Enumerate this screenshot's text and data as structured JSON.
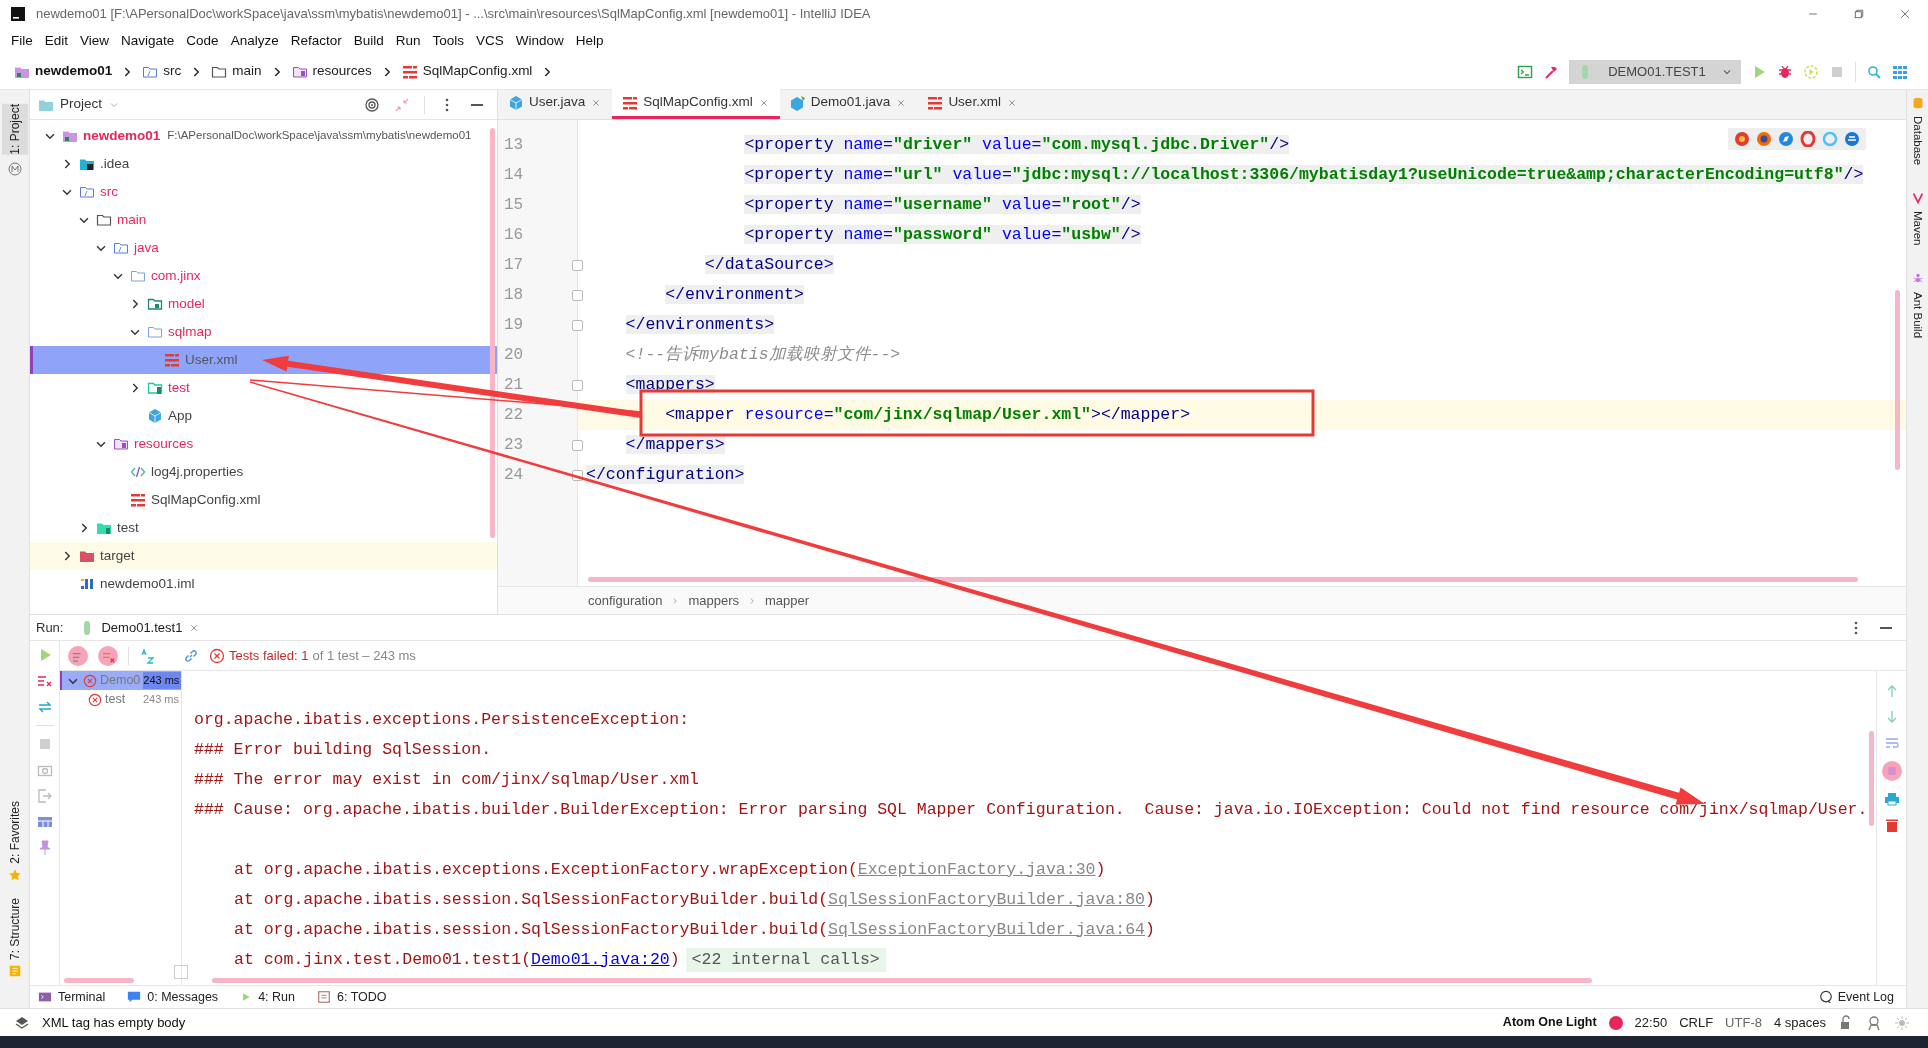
{
  "window": {
    "title": "newdemo01 [F:\\APersonalDoc\\workSpace\\java\\ssm\\mybatis\\newdemo01] - ...\\src\\main\\resources\\SqlMapConfig.xml [newdemo01] - IntelliJ IDEA"
  },
  "menu": [
    "File",
    "Edit",
    "View",
    "Navigate",
    "Code",
    "Analyze",
    "Refactor",
    "Build",
    "Run",
    "Tools",
    "VCS",
    "Window",
    "Help"
  ],
  "nav_path": [
    {
      "label": "newdemo01",
      "kind": "module"
    },
    {
      "label": "src",
      "kind": "source-folder"
    },
    {
      "label": "main",
      "kind": "folder"
    },
    {
      "label": "resources",
      "kind": "resources-folder"
    },
    {
      "label": "SqlMapConfig.xml",
      "kind": "xml"
    }
  ],
  "run_config": {
    "label": "DEMO01.TEST1"
  },
  "left_stripe": [
    {
      "label": "1: Project",
      "selected": true
    },
    {
      "label": "2: Favorites",
      "selected": false
    },
    {
      "label": "7: Structure",
      "selected": false
    }
  ],
  "right_stripe": [
    "Database",
    "Maven",
    "Ant Build"
  ],
  "project_panel": {
    "title": "Project",
    "tree": [
      {
        "label": "newdemo01",
        "path": "F:\\APersonalDoc\\workSpace\\java\\ssm\\mybatis\\newdemo01",
        "kind": "module",
        "color": "#e8265e",
        "selected": false,
        "expanded": true,
        "children": [
          {
            "label": ".idea",
            "kind": "idea-folder",
            "color": "#444444",
            "selected": false,
            "expanded": false
          },
          {
            "label": "src",
            "kind": "source-folder",
            "color": "#e8265e",
            "selected": false,
            "expanded": true,
            "children": [
              {
                "label": "main",
                "kind": "folder",
                "color": "#e8265e",
                "selected": false,
                "expanded": true,
                "children": [
                  {
                    "label": "java",
                    "kind": "source-folder",
                    "color": "#e8265e",
                    "selected": false,
                    "expanded": true,
                    "children": [
                      {
                        "label": "com.jinx",
                        "kind": "package",
                        "color": "#e8265e",
                        "selected": false,
                        "expanded": true,
                        "children": [
                          {
                            "label": "model",
                            "kind": "model-package",
                            "color": "#e8265e",
                            "selected": false,
                            "expanded": false
                          },
                          {
                            "label": "sqlmap",
                            "kind": "package",
                            "color": "#e8265e",
                            "selected": false,
                            "expanded": true,
                            "children": [
                              {
                                "label": "User.xml",
                                "kind": "xml",
                                "color": "#555555",
                                "selected": true
                              }
                            ]
                          },
                          {
                            "label": "test",
                            "kind": "test-package",
                            "color": "#e8265e",
                            "selected": false,
                            "expanded": false
                          },
                          {
                            "label": "App",
                            "kind": "java-class",
                            "color": "#444444",
                            "selected": false
                          }
                        ]
                      }
                    ]
                  },
                  {
                    "label": "resources",
                    "kind": "resources-folder",
                    "color": "#e8265e",
                    "selected": false,
                    "expanded": true,
                    "children": [
                      {
                        "label": "log4j.properties",
                        "kind": "properties",
                        "color": "#444444",
                        "selected": false
                      },
                      {
                        "label": "SqlMapConfig.xml",
                        "kind": "xml",
                        "color": "#444444",
                        "selected": false
                      }
                    ]
                  }
                ]
              },
              {
                "label": "test",
                "kind": "test-folder",
                "color": "#444444",
                "selected": false,
                "expanded": false
              }
            ]
          },
          {
            "label": "target",
            "kind": "excluded-folder",
            "color": "#444444",
            "selected": false,
            "expanded": false
          },
          {
            "label": "newdemo01.iml",
            "kind": "iml",
            "color": "#444444",
            "selected": false
          }
        ]
      }
    ]
  },
  "editor": {
    "tabs": [
      {
        "label": "User.java",
        "kind": "java-class",
        "selected": false
      },
      {
        "label": "SqlMapConfig.xml",
        "kind": "xml",
        "selected": true
      },
      {
        "label": "Demo01.java",
        "kind": "java-test",
        "selected": false
      },
      {
        "label": "User.xml",
        "kind": "xml",
        "selected": false
      }
    ],
    "lines": [
      {
        "number": "13",
        "highlighted": true,
        "current": false,
        "fold_marker": false,
        "tokens": [
          {
            "kind": "tag",
            "text": "                <property"
          },
          {
            "kind": "attr",
            "text": " name="
          },
          {
            "kind": "value",
            "text": "\"driver\""
          },
          {
            "kind": "attr",
            "text": " value="
          },
          {
            "kind": "value",
            "text": "\"com.mysql.jdbc.Driver\""
          },
          {
            "kind": "tag",
            "text": "/>"
          }
        ]
      },
      {
        "number": "14",
        "highlighted": true,
        "current": false,
        "fold_marker": false,
        "tokens": [
          {
            "kind": "tag",
            "text": "                <property"
          },
          {
            "kind": "attr",
            "text": " name="
          },
          {
            "kind": "value",
            "text": "\"url\""
          },
          {
            "kind": "attr",
            "text": " value="
          },
          {
            "kind": "value",
            "text": "\"jdbc:mysql://localhost:3306/mybatisday1?useUnicode=true&amp;characterEncoding=utf8\""
          },
          {
            "kind": "tag",
            "text": "/>"
          }
        ]
      },
      {
        "number": "15",
        "highlighted": true,
        "current": false,
        "fold_marker": false,
        "tokens": [
          {
            "kind": "tag",
            "text": "                <property"
          },
          {
            "kind": "attr",
            "text": " name="
          },
          {
            "kind": "value",
            "text": "\"username\""
          },
          {
            "kind": "attr",
            "text": " value="
          },
          {
            "kind": "value",
            "text": "\"root\""
          },
          {
            "kind": "tag",
            "text": "/>"
          }
        ]
      },
      {
        "number": "16",
        "highlighted": true,
        "current": false,
        "fold_marker": false,
        "tokens": [
          {
            "kind": "tag",
            "text": "                <property"
          },
          {
            "kind": "attr",
            "text": " name="
          },
          {
            "kind": "value",
            "text": "\"password\""
          },
          {
            "kind": "attr",
            "text": " value="
          },
          {
            "kind": "value",
            "text": "\"usbw\""
          },
          {
            "kind": "tag",
            "text": "/>"
          }
        ]
      },
      {
        "number": "17",
        "highlighted": true,
        "current": false,
        "fold_marker": true,
        "tokens": [
          {
            "kind": "tag",
            "text": "            </dataSource>"
          }
        ]
      },
      {
        "number": "18",
        "highlighted": true,
        "current": false,
        "fold_marker": true,
        "tokens": [
          {
            "kind": "tag",
            "text": "        </environment>"
          }
        ]
      },
      {
        "number": "19",
        "highlighted": true,
        "current": false,
        "fold_marker": true,
        "tokens": [
          {
            "kind": "tag",
            "text": "    </environments>"
          }
        ]
      },
      {
        "number": "20",
        "highlighted": false,
        "current": false,
        "fold_marker": false,
        "tokens": [
          {
            "kind": "comment",
            "text": "    <!--告诉mybatis加载映射文件-->"
          }
        ]
      },
      {
        "number": "21",
        "highlighted": true,
        "current": false,
        "fold_marker": true,
        "tokens": [
          {
            "kind": "tag",
            "text": "    <mappers>"
          }
        ]
      },
      {
        "number": "22",
        "highlighted": false,
        "current": true,
        "fold_marker": false,
        "tokens": [
          {
            "kind": "tag",
            "text": "        <mapper"
          },
          {
            "kind": "attr",
            "text": " resource="
          },
          {
            "kind": "value",
            "text": "\"com/jinx/sqlmap/User.xml\""
          },
          {
            "kind": "tag",
            "text": "></mapper>"
          }
        ]
      },
      {
        "number": "23",
        "highlighted": true,
        "current": false,
        "fold_marker": true,
        "tokens": [
          {
            "kind": "tag",
            "text": "    </mappers>"
          }
        ]
      },
      {
        "number": "24",
        "highlighted": true,
        "current": false,
        "fold_marker": true,
        "tokens": [
          {
            "kind": "tag",
            "text": "</configuration>"
          }
        ]
      }
    ],
    "breadcrumb": [
      "configuration",
      "mappers",
      "mapper"
    ]
  },
  "run_panel": {
    "label": "Run:",
    "tab": "Demo01.test1",
    "failed": "Tests failed: 1",
    "summary": "of 1 test – 243 ms",
    "tests": [
      {
        "label": "Demo0",
        "time": "243 ms",
        "selected": true,
        "expanded": true,
        "children": [
          {
            "label": "test",
            "time": "243 ms",
            "selected": false
          }
        ]
      }
    ],
    "console": [
      {
        "kind": "error",
        "text": "org.apache.ibatis.exceptions.PersistenceException:"
      },
      {
        "kind": "error",
        "text": "### Error building SqlSession."
      },
      {
        "kind": "error",
        "text": "### The error may exist in com/jinx/sqlmap/User.xml"
      },
      {
        "kind": "error",
        "text": "### Cause: org.apache.ibatis.builder.BuilderException: Error parsing SQL Mapper Configuration.  Cause: java.io.IOException: Could not find resource com/jinx/sqlmap/User."
      },
      {
        "kind": "blank"
      },
      {
        "kind": "frame",
        "text": "at org.apache.ibatis.exceptions.ExceptionFactory.wrapException(",
        "link": "ExceptionFactory.java:30",
        "close": ")"
      },
      {
        "kind": "frame",
        "text": "at org.apache.ibatis.session.SqlSessionFactoryBuilder.build(",
        "link": "SqlSessionFactoryBuilder.java:80",
        "close": ")"
      },
      {
        "kind": "frame",
        "text": "at org.apache.ibatis.session.SqlSessionFactoryBuilder.build(",
        "link": "SqlSessionFactoryBuilder.java:64",
        "close": ")"
      },
      {
        "kind": "user-frame",
        "text": "at com.jinx.test.Demo01.test1(",
        "link": "Demo01.java:20",
        "close": ")",
        "folded": "<22 internal calls>"
      }
    ]
  },
  "tool_tabs": [
    {
      "label": "Terminal",
      "kind": "terminal"
    },
    {
      "label": "0: Messages",
      "kind": "messages"
    },
    {
      "label": "4: Run",
      "kind": "run"
    },
    {
      "label": "6: TODO",
      "kind": "todo"
    }
  ],
  "event_log": "Event Log",
  "status_bar": {
    "message": "XML tag has empty body",
    "theme": "Atom One Light",
    "position": "22:50",
    "line_separator": "CRLF",
    "encoding": "UTF-8",
    "indent": "4 spaces"
  }
}
